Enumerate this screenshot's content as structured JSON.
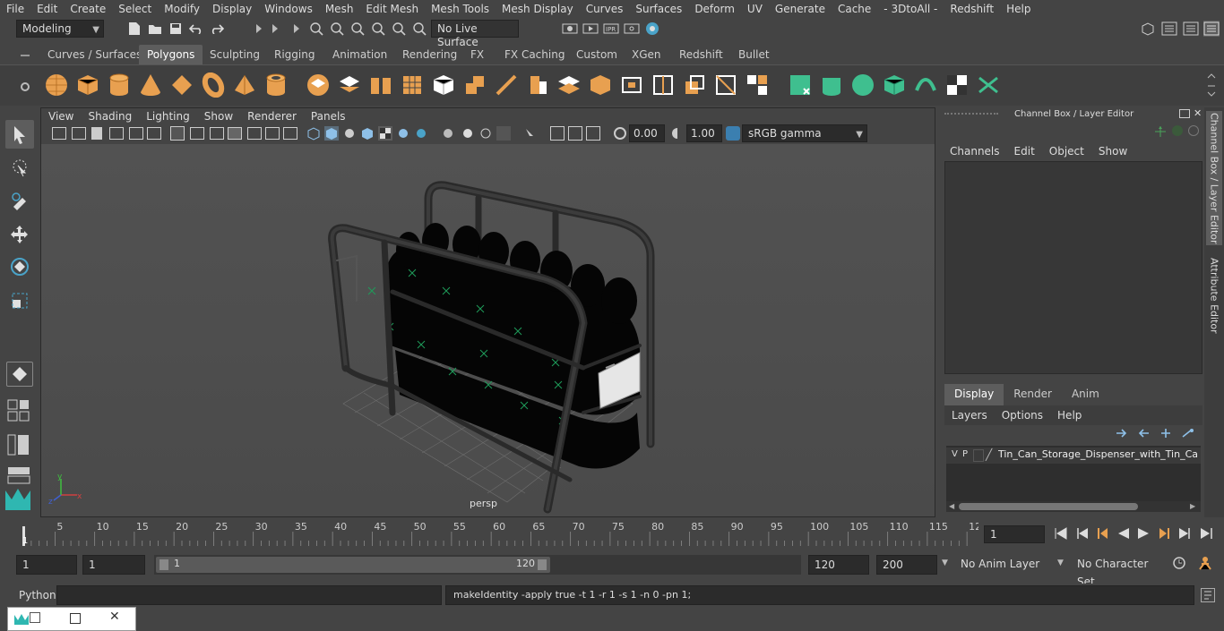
{
  "menubar": {
    "items": [
      "File",
      "Edit",
      "Create",
      "Select",
      "Modify",
      "Display",
      "Windows",
      "Mesh",
      "Edit Mesh",
      "Mesh Tools",
      "Mesh Display",
      "Curves",
      "Surfaces",
      "Deform",
      "UV",
      "Generate",
      "Cache",
      "- 3DtoAll -",
      "Redshift",
      "Help"
    ]
  },
  "statusline": {
    "mode": "Modeling",
    "live_surface": "No Live Surface"
  },
  "shelf": {
    "tabs": [
      "Curves / Surfaces",
      "Polygons",
      "Sculpting",
      "Rigging",
      "Animation",
      "Rendering",
      "FX",
      "FX Caching",
      "Custom",
      "XGen",
      "Redshift",
      "Bullet"
    ],
    "active_tab": "Polygons"
  },
  "viewport": {
    "menu": [
      "View",
      "Shading",
      "Lighting",
      "Show",
      "Renderer",
      "Panels"
    ],
    "exposure": "0.00",
    "gamma": "1.00",
    "color_space": "sRGB gamma",
    "camera_label": "persp"
  },
  "channel_box": {
    "title": "Channel Box / Layer Editor",
    "menu": [
      "Channels",
      "Edit",
      "Object",
      "Show"
    ],
    "layer_tabs": [
      "Display",
      "Render",
      "Anim"
    ],
    "active_layer_tab": "Display",
    "layer_menu": [
      "Layers",
      "Options",
      "Help"
    ],
    "layer": {
      "v": "V",
      "p": "P",
      "name": "Tin_Can_Storage_Dispenser_with_Tin_Cans"
    }
  },
  "side_tabs": [
    "Channel Box / Layer Editor",
    "Attribute Editor"
  ],
  "timeline": {
    "ticks": [
      "5",
      "10",
      "15",
      "20",
      "25",
      "30",
      "35",
      "40",
      "45",
      "50",
      "55",
      "60",
      "65",
      "70",
      "75",
      "80",
      "85",
      "90",
      "95",
      "100",
      "105",
      "110",
      "115",
      "12"
    ],
    "start_marker": "1",
    "current_frame": "1"
  },
  "range": {
    "start": "1",
    "playback_start": "1",
    "slider_start": "1",
    "slider_end": "120",
    "playback_end": "120",
    "end": "200",
    "anim_layer": "No Anim Layer",
    "character_set": "No Character Set"
  },
  "command": {
    "language": "Python",
    "feedback": "makeIdentity -apply true -t 1 -r 1 -s 1 -n 0 -pn 1;"
  },
  "colors": {
    "bg": "#444444",
    "accent": "#5285a6",
    "shelf_icon": "#e8a050",
    "shelf_icon_green": "#3fbf8f"
  }
}
